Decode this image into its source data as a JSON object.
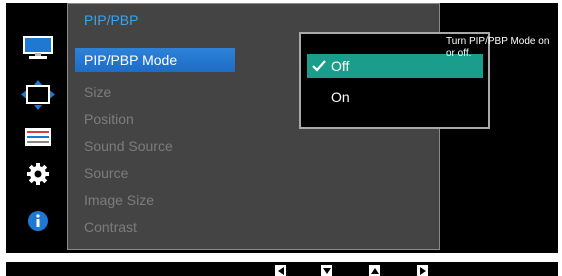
{
  "menu": {
    "title": "PIP/PBP",
    "items": [
      {
        "label": "PIP/PBP Mode",
        "active": true
      },
      {
        "label": "Size"
      },
      {
        "label": "Position"
      },
      {
        "label": "Sound Source"
      },
      {
        "label": "Source"
      },
      {
        "label": "Image Size"
      },
      {
        "label": "Contrast"
      }
    ]
  },
  "submenu": {
    "options": [
      {
        "label": "Off",
        "selected": true
      },
      {
        "label": "On"
      }
    ]
  },
  "help_text": "Turn PIP/PBP Mode on or off.",
  "sidebar_icons": [
    "picture-icon",
    "pip-pbp-icon",
    "system-settings-icon",
    "gear-icon",
    "information-icon"
  ],
  "nav_keys": [
    "left-arrow-key-icon",
    "down-arrow-key-icon",
    "up-arrow-key-icon",
    "right-arrow-key-icon"
  ],
  "colors": {
    "panel_bg": "#444444",
    "title": "#3aa3f2",
    "active_item": "#2d82d8",
    "selected_option": "#1a9d8a",
    "inactive_text": "#7c7c7c"
  }
}
